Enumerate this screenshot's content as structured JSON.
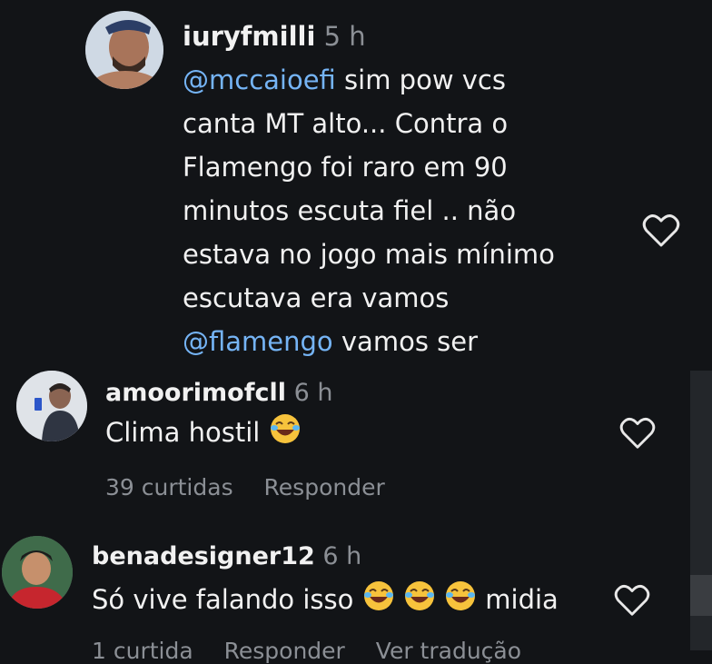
{
  "comments": [
    {
      "username": "iuryfmilli",
      "time": "5 h",
      "lines": [
        {
          "mention": "@mccaioefi",
          "text": " sim pow vcs"
        },
        {
          "mention": "",
          "text": "canta MT alto... Contra o"
        },
        {
          "mention": "",
          "text": "Flamengo foi raro em 90"
        },
        {
          "mention": "",
          "text": "minutos escuta fiel .. não"
        },
        {
          "mention": "",
          "text": "estava no jogo mais mínimo"
        },
        {
          "mention": "",
          "text": "escutava era vamos"
        },
        {
          "mention": "@flamengo",
          "text": " vamos ser"
        }
      ]
    },
    {
      "username": "amoorimofcll",
      "time": "6 h",
      "text": "Clima hostil",
      "emoji": "laughing-face-icon",
      "likes": "39 curtidas",
      "reply": "Responder"
    },
    {
      "username": "benadesigner12",
      "time": "6 h",
      "text_before": "Só vive falando isso",
      "text_after": "midia",
      "emoji": "laughing-face-icon"
    }
  ],
  "bottom_meta": {
    "likes": "1 curtida",
    "reply": "Responder",
    "translate": "Ver tradução"
  },
  "colors": {
    "background": "#121417",
    "mention": "#75b4f5",
    "secondary_text": "#8b8f95"
  }
}
